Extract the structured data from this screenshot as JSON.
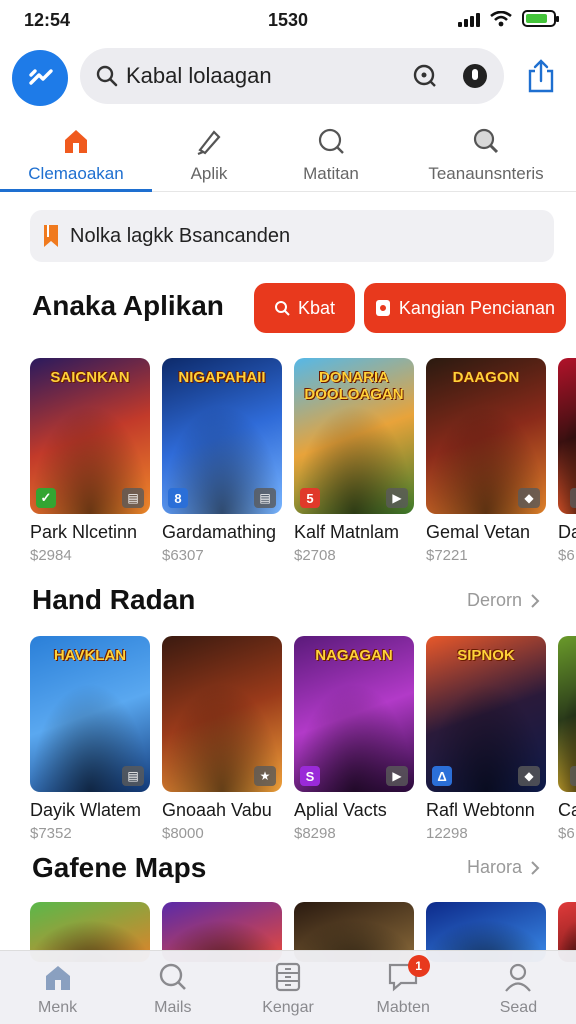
{
  "status_bar": {
    "time_left": "12:54",
    "time_center": "1530"
  },
  "search": {
    "text": "Kabal lolaagan"
  },
  "tabs": [
    {
      "label": "Clemaoakan",
      "icon": "home-icon",
      "active": true
    },
    {
      "label": "Aplik",
      "icon": "pen-icon",
      "active": false
    },
    {
      "label": "Matitan",
      "icon": "search-icon",
      "active": false
    },
    {
      "label": "Teanaunsnteris",
      "icon": "search-icon",
      "active": false
    }
  ],
  "banner": {
    "text": "Nolka lagkk Bsancanden"
  },
  "section1": {
    "title": "Anaka Aplikan",
    "button1": "Kbat",
    "button2": "Kangian Pencianan",
    "cards": [
      {
        "logo": "SAICNKAN",
        "name": "Park Nlcetinn",
        "price": "$2984",
        "badge_left": "✓",
        "badge_left_color": "#33a532",
        "badge_right": "▤",
        "gradient": [
          "#2a1a5e",
          "#c23a2a",
          "#f08a2a"
        ]
      },
      {
        "logo": "NIGAPAHAII",
        "name": "Gardamathing",
        "price": "$6307",
        "badge_left": "8",
        "badge_left_color": "#2b6fd8",
        "badge_right": "▤",
        "gradient": [
          "#0d2a6a",
          "#2f6bd8",
          "#7ab6ff"
        ]
      },
      {
        "logo": "DONARIA DOOLOAGAN",
        "name": "Kalf Matnlam",
        "price": "$2708",
        "badge_left": "5",
        "badge_left_color": "#e0392a",
        "badge_right": "▶",
        "gradient": [
          "#55b8e8",
          "#e8a33a",
          "#3c7a2a"
        ]
      },
      {
        "logo": "DAAGON",
        "name": "Gemal Vetan",
        "price": "$7221",
        "badge_left": "",
        "badge_left_color": "transparent",
        "badge_right": "◆",
        "gradient": [
          "#2a1a10",
          "#8a2a1a",
          "#e0822a"
        ]
      },
      {
        "logo": "",
        "name": "Da",
        "price": "$6",
        "badge_left": "",
        "badge_left_color": "transparent",
        "badge_right": "L",
        "gradient": [
          "#b2122a",
          "#3a1010",
          "#e85a2a"
        ]
      }
    ]
  },
  "section2": {
    "title": "Hand Radan",
    "more": "Derorn",
    "cards": [
      {
        "logo": "HAVKLAN",
        "name": "Dayik Wlatem",
        "price": "$7352",
        "badge_left": "",
        "badge_left_color": "transparent",
        "badge_right": "▤",
        "gradient": [
          "#2a7fd8",
          "#5aa8f0",
          "#123a7a"
        ]
      },
      {
        "logo": "",
        "name": "Gnoaah Vabu",
        "price": "$8000",
        "badge_left": "",
        "badge_left_color": "transparent",
        "badge_right": "★",
        "gradient": [
          "#3a1a10",
          "#9a3a1a",
          "#f0a23a"
        ]
      },
      {
        "logo": "NAGAGAN",
        "name": "Aplial Vacts",
        "price": "$8298",
        "badge_left": "S",
        "badge_left_color": "#9a2ad8",
        "badge_right": "▶",
        "gradient": [
          "#5a1a7a",
          "#b23ac8",
          "#2a0a3a"
        ]
      },
      {
        "logo": "SIPNOK",
        "name": "Rafl Webtonn",
        "price": "12298",
        "badge_left": "Δ",
        "badge_left_color": "#2b6fd8",
        "badge_right": "◆",
        "gradient": [
          "#e8582a",
          "#2a1a3a",
          "#0d1a4a"
        ]
      },
      {
        "logo": "",
        "name": "Ca",
        "price": "$6",
        "badge_left": "",
        "badge_left_color": "transparent",
        "badge_right": "▤",
        "gradient": [
          "#6a9a2a",
          "#2a3a1a",
          "#c8a02a"
        ]
      }
    ]
  },
  "section3": {
    "title": "Gafene Maps",
    "more": "Harora",
    "cards": [
      {
        "gradient": [
          "#5ab84a",
          "#e0822a"
        ]
      },
      {
        "gradient": [
          "#5a2aa8",
          "#e84a3a"
        ]
      },
      {
        "gradient": [
          "#2a1a10",
          "#8a6a3a"
        ]
      },
      {
        "gradient": [
          "#0d2a8a",
          "#3a8ae8"
        ]
      },
      {
        "gradient": [
          "#e03a3a",
          "#7a1a1a"
        ]
      }
    ]
  },
  "bottom_nav": [
    {
      "label": "Menk",
      "icon": "home-icon",
      "active": true
    },
    {
      "label": "Mails",
      "icon": "search-icon",
      "active": false
    },
    {
      "label": "Kengar",
      "icon": "cabinet-icon",
      "active": false
    },
    {
      "label": "Mabten",
      "icon": "chat-icon",
      "active": false,
      "badge": "1"
    },
    {
      "label": "Sead",
      "icon": "person-icon",
      "active": false
    }
  ]
}
